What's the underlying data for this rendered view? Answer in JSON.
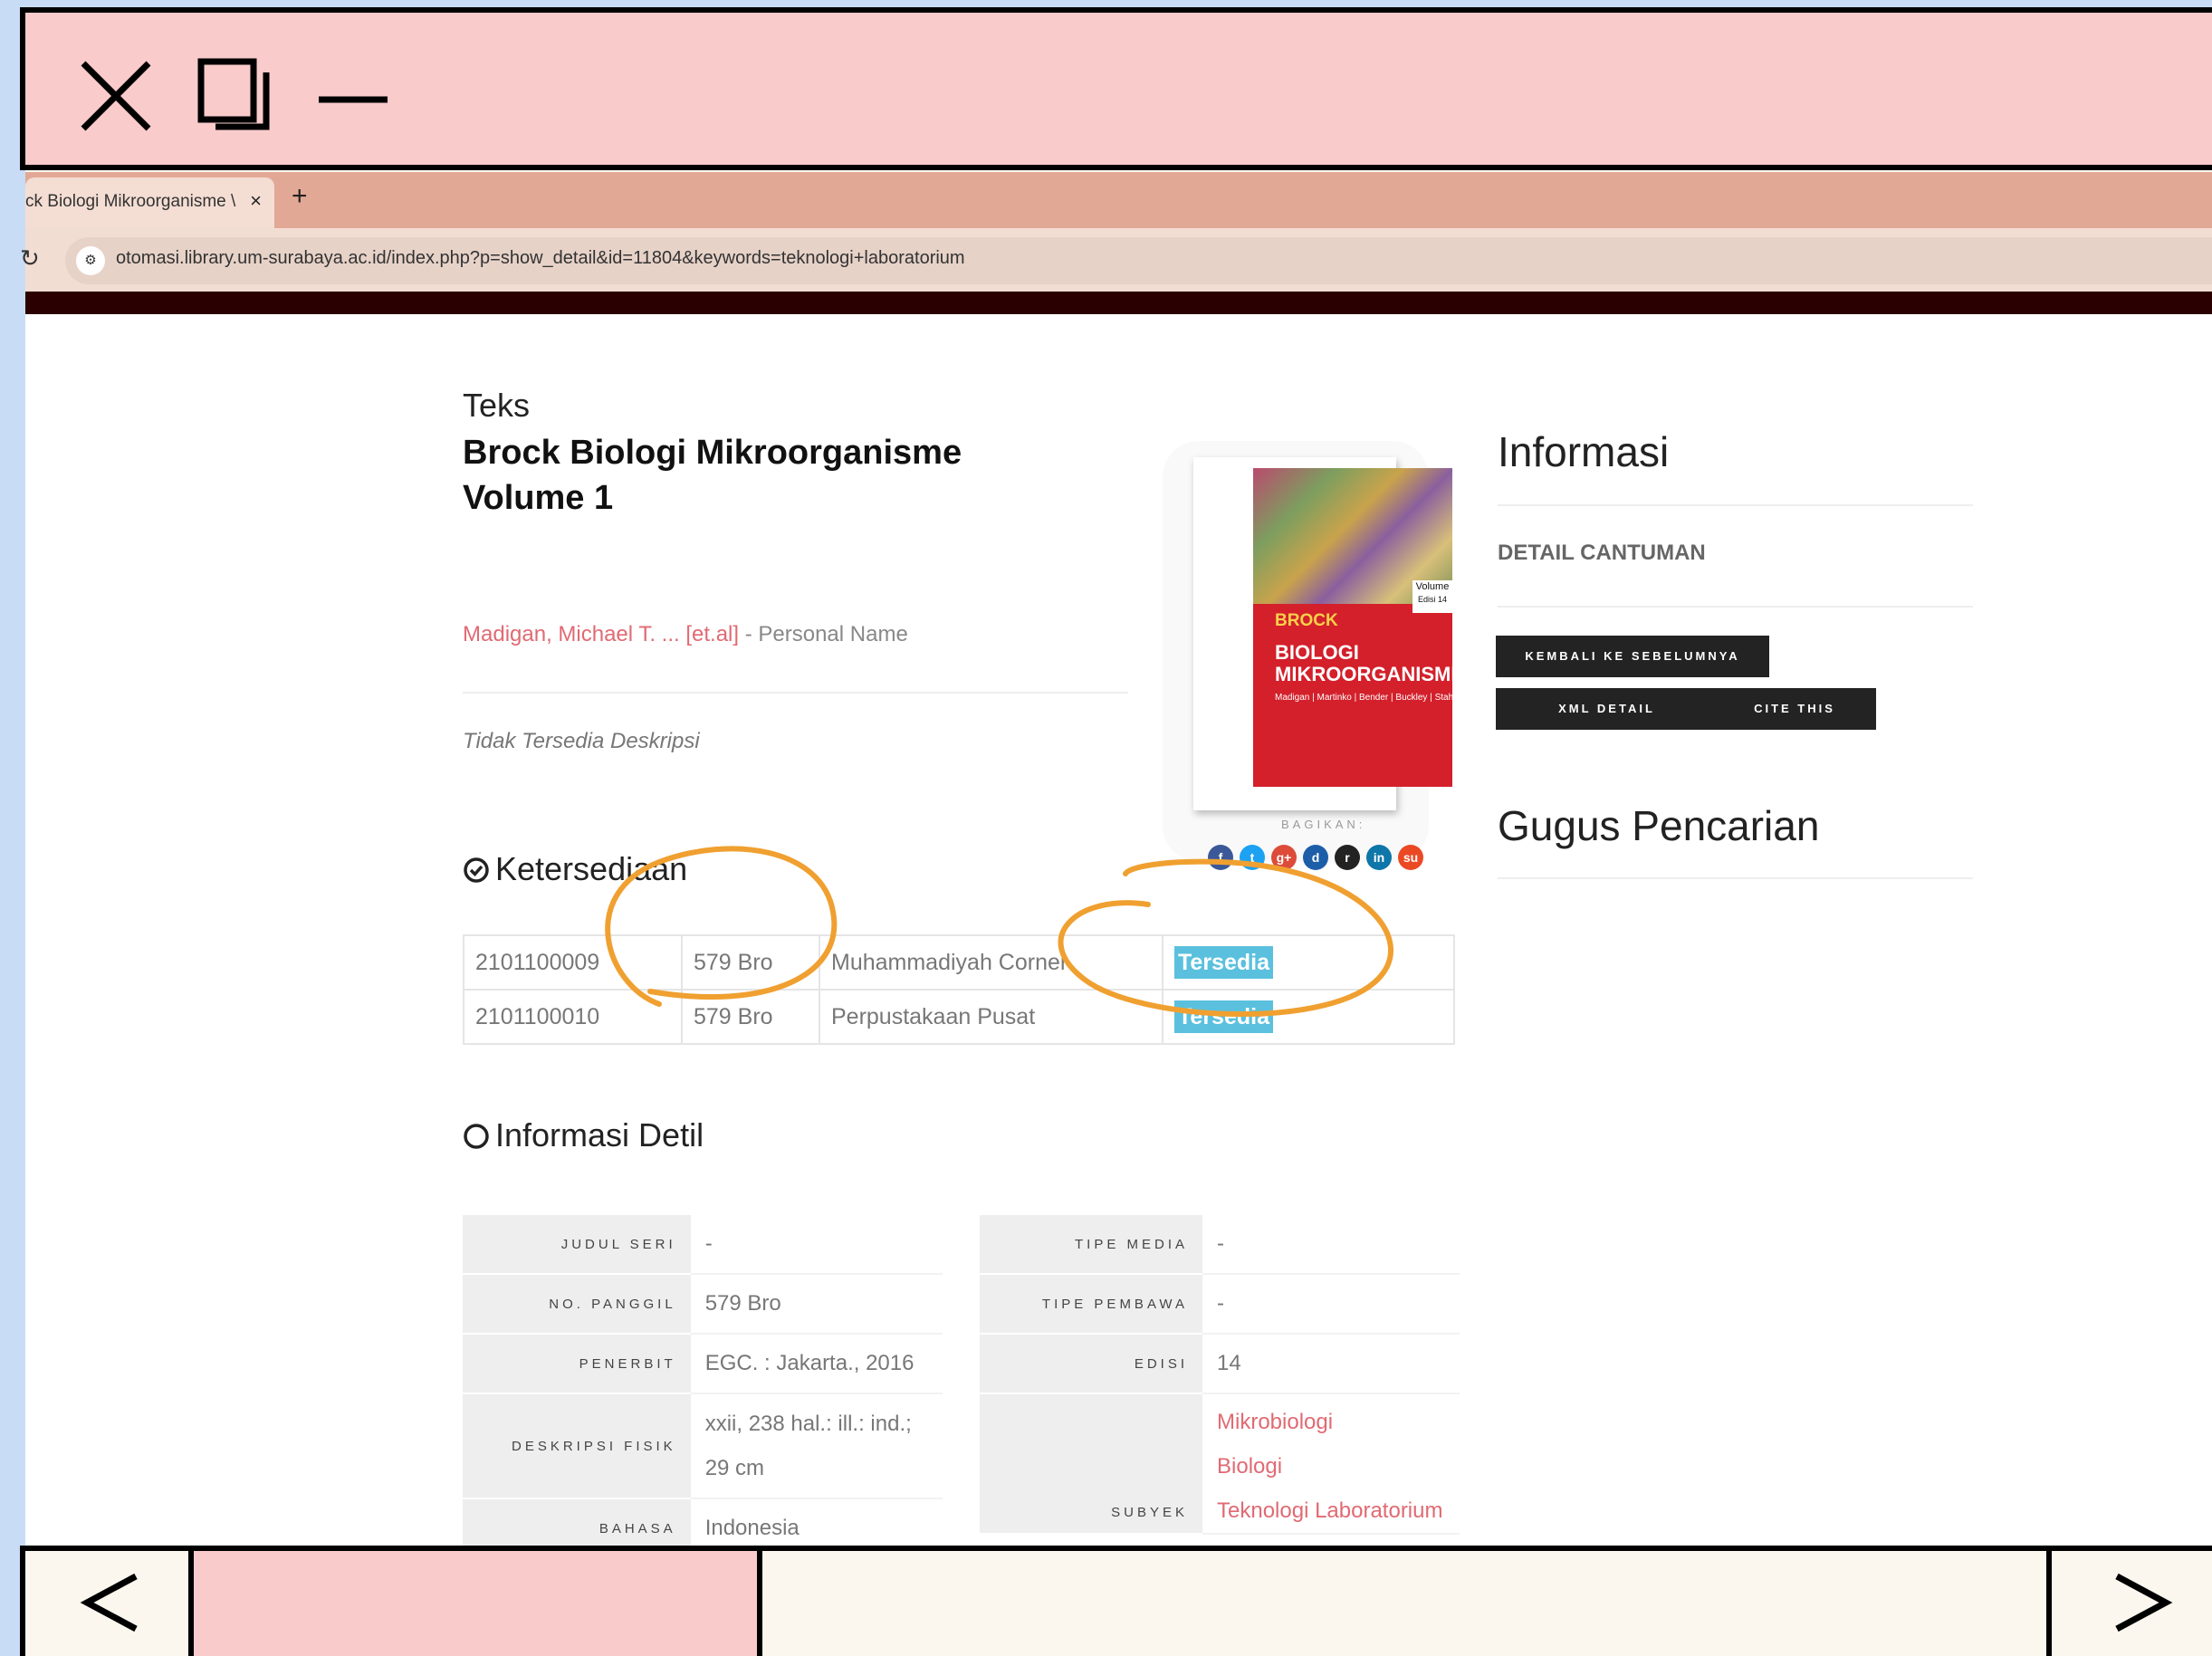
{
  "browser": {
    "tab_title": "ck Biologi Mikroorganisme \\",
    "tab_close": "×",
    "new_tab": "+",
    "url": "otomasi.library.um-surabaya.ac.id/index.php?p=show_detail&id=11804&keywords=teknologi+laboratorium"
  },
  "item": {
    "gmd": "Teks",
    "title": "Brock Biologi Mikroorganisme Volume 1",
    "author": "Madigan, Michael T. ... [et.al]",
    "author_role": " - Personal Name",
    "notes": "Tidak Tersedia Deskripsi"
  },
  "availability": {
    "heading": "Ketersediaan",
    "rows": [
      {
        "code": "2101100009",
        "call": "579 Bro",
        "location": "Muhammadiyah Corner",
        "status": "Tersedia"
      },
      {
        "code": "2101100010",
        "call": "579 Bro",
        "location": "Perpustakaan Pusat",
        "status": "Tersedia"
      }
    ]
  },
  "detail": {
    "heading": "Informasi Detil",
    "left": [
      {
        "label": "JUDUL SERI",
        "value": "-"
      },
      {
        "label": "NO. PANGGIL",
        "value": "579 Bro"
      },
      {
        "label": "PENERBIT",
        "value": "EGC. : Jakarta., 2016"
      },
      {
        "label": "DESKRIPSI FISIK",
        "value": "xxii, 238 hal.: ill.: ind.; 29 cm"
      },
      {
        "label": "BAHASA",
        "value": "Indonesia"
      }
    ],
    "right": [
      {
        "label": "TIPE MEDIA",
        "value": "-"
      },
      {
        "label": "TIPE PEMBAWA",
        "value": "-"
      },
      {
        "label": "EDISI",
        "value": "14"
      },
      {
        "label": "SUBYEK",
        "values": [
          "Mikrobiologi",
          "Biologi",
          "Teknologi Laboratorium"
        ]
      }
    ]
  },
  "cover": {
    "brand": "BROCK",
    "title_line1": "BIOLOGI",
    "title_line2": "MIKROORGANISME",
    "authors": "Madigan | Martinko | Bender | Buckley | Stahl",
    "volume": "Volume",
    "edition": "Edisi 14"
  },
  "share": {
    "label": "BAGIKAN:",
    "icons": [
      {
        "name": "facebook-icon",
        "glyph": "f",
        "color": "#3b5998"
      },
      {
        "name": "twitter-icon",
        "glyph": "t",
        "color": "#1da1f2"
      },
      {
        "name": "google-plus-icon",
        "glyph": "g+",
        "color": "#dd4b39"
      },
      {
        "name": "digg-icon",
        "glyph": "d",
        "color": "#1d5ea8"
      },
      {
        "name": "reddit-icon",
        "glyph": "r",
        "color": "#222222"
      },
      {
        "name": "linkedin-icon",
        "glyph": "in",
        "color": "#0e76a8"
      },
      {
        "name": "stumbleupon-icon",
        "glyph": "su",
        "color": "#eb4924"
      }
    ]
  },
  "sidebar": {
    "info_title": "Informasi",
    "detail_heading": "DETAIL CANTUMAN",
    "back_button": "KEMBALI KE SEBELUMNYA",
    "xml_button": "XML DETAIL",
    "cite_button": "CITE THIS",
    "search_cluster": "Gugus Pencarian"
  },
  "colors": {
    "frame_pink": "#f9cbcb",
    "tab_strip": "#e2a896",
    "link": "#e06a73",
    "badge": "#5bc0de",
    "annotation_orange": "#f0a030"
  }
}
